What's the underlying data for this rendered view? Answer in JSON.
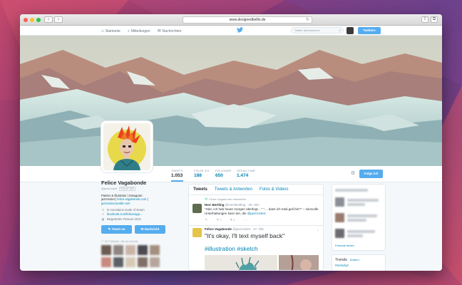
{
  "browser": {
    "url": "www.designedbellin.de"
  },
  "topbar": {
    "nav": [
      {
        "label": "Startseite",
        "icon": "home-icon"
      },
      {
        "label": "Mitteilungen",
        "icon": "bell-icon"
      },
      {
        "label": "Nachrichten",
        "icon": "envelope-icon"
      }
    ],
    "search_placeholder": "Twitter durchsuchen",
    "tweet_button": "Twittern"
  },
  "profile_nav": {
    "stats": [
      {
        "label": "TWEETS",
        "value": "1.053"
      },
      {
        "label": "FOLGE ICH",
        "value": "188"
      },
      {
        "label": "FOLLOWER",
        "value": "650"
      },
      {
        "label": "GEFÄLLT MIR",
        "value": "1.474"
      }
    ],
    "follow_button": "Folge ich"
  },
  "profile": {
    "name": "Felice Vagabonde",
    "handle": "@jazzrocket",
    "follows_you": "FOLGT DIR",
    "bio_line1": "Painter & Illustrator | instagram:",
    "bio_line2_prefix": "jazzrocket |",
    "bio_link1": "felice-vagabonde.com",
    "bio_line2_suffix": "|",
    "bio_link2": "jazzrocket.tumblr.com",
    "location": "in mountains made of steam",
    "url": "facebook.com/felicevaga...",
    "joined": "Beigetreten Februar 2013",
    "tweet_to_button": "Tweet an",
    "message_button": "Nachricht",
    "followers_you_know": "33 Follower, die du kennst"
  },
  "timeline": {
    "tabs": [
      "Tweets",
      "Tweets & Antworten",
      "Fotos & Videos"
    ],
    "retweet_note": "Felice Vagabonde retweetete",
    "tweet1": {
      "name": "Herr Bertling",
      "handle": "@HerrBertling",
      "date": "· 28. Okt.",
      "text": "\"Hier, ich hab heute morgen überlegt…\" \"… dass ich total geil bin?\" – sinnvolle Unterhaltungen kann sie, die",
      "mention": "@jazzrocket.",
      "retweets": "1",
      "likes": "6"
    },
    "tweet2": {
      "name": "Felice Vagabonde",
      "handle": "@jazzrocket",
      "date": "· 27. Okt.",
      "text": "\"It's okay, I'll text myself back\"",
      "tags": "#illustration #sketch"
    }
  },
  "sidebar": {
    "find_friends": "Freunde finden",
    "trends_title": "Trends",
    "trends_change": "· Ändern",
    "trend1": "#SchiefuZ"
  },
  "colors": {
    "accent": "#55acee",
    "link": "#0084b4"
  }
}
